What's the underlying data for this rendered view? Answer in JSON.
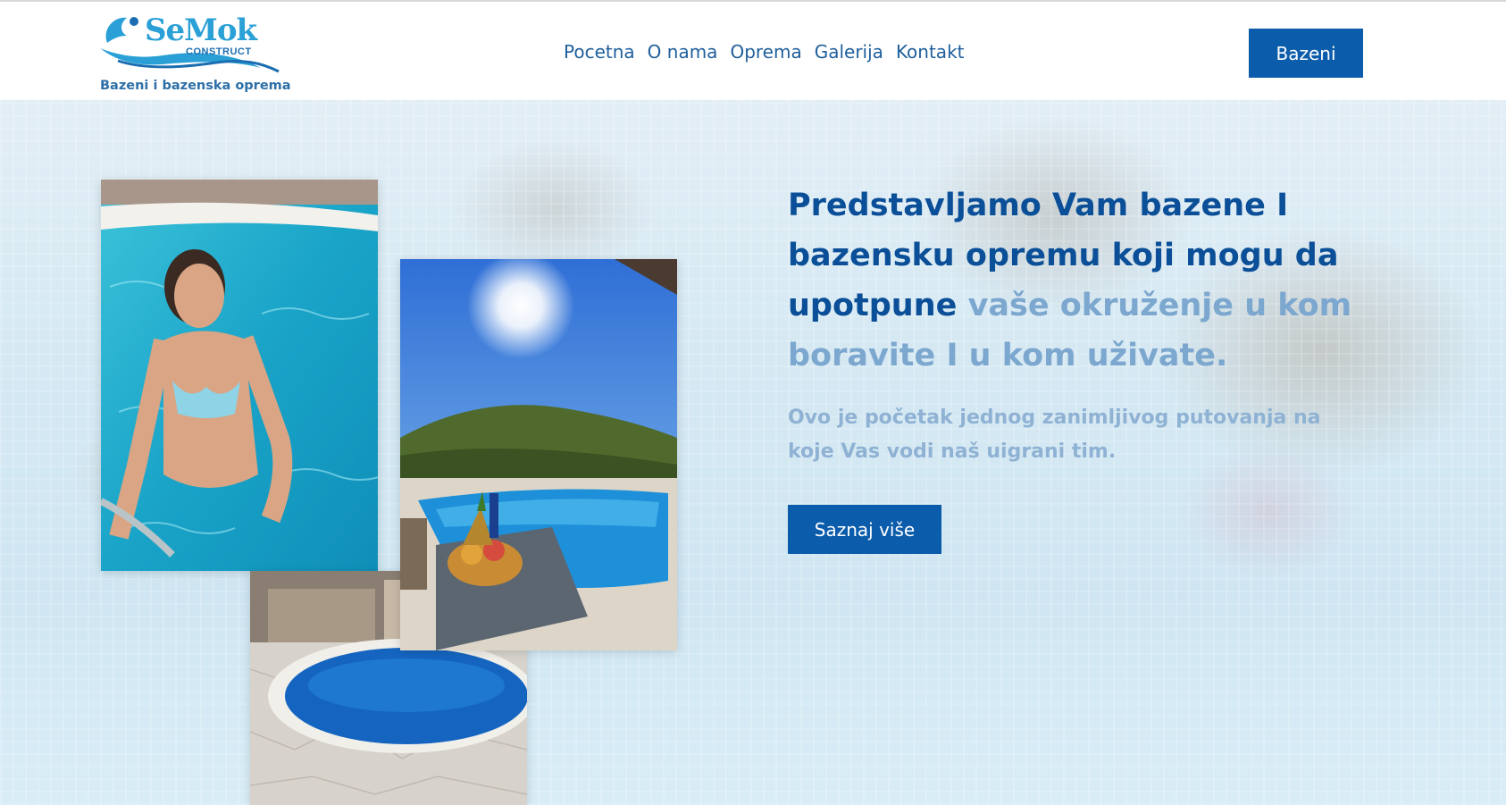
{
  "header": {
    "logo": {
      "name": "SeMok",
      "sub": "CONSTRUCT"
    },
    "tagline": "Bazeni i bazenska oprema",
    "nav": [
      {
        "label": "Pocetna"
      },
      {
        "label": "O nama"
      },
      {
        "label": "Oprema"
      },
      {
        "label": "Galerija"
      },
      {
        "label": "Kontakt"
      }
    ],
    "cta_label": "Bazeni"
  },
  "hero": {
    "headline_dark": "Predstavljamo Vam bazene I bazensku opremu koji mogu da upotpune",
    "headline_light": "vaše okruženje u kom boravite I u kom uživate.",
    "subtext": "Ovo je početak jednog zanimljivog putovanja na koje Vas vodi naš uigrani tim.",
    "cta_label": "Saznaj više"
  },
  "colors": {
    "brand_blue": "#0b5cab",
    "nav_text": "#1f5f9c",
    "headline_dark": "#0a4f98",
    "headline_light": "#7ca7cf",
    "subtext": "#8fb2d4",
    "logo_blue": "#2aa0d6"
  }
}
